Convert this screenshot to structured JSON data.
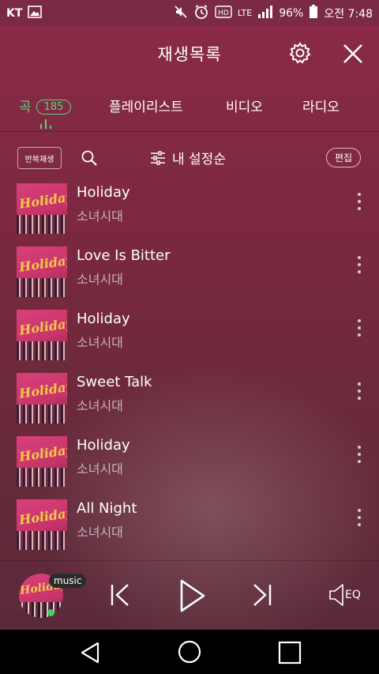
{
  "status_bar": {
    "carrier": "KT",
    "lte": "LTE",
    "battery": "96%",
    "time": "오전 7:48"
  },
  "header": {
    "title": "재생목록"
  },
  "tabs": [
    {
      "label": "곡",
      "badge": "185",
      "active": true
    },
    {
      "label": "플레이리스트",
      "active": false
    },
    {
      "label": "비디오",
      "active": false
    },
    {
      "label": "라디오",
      "active": false
    }
  ],
  "toolbar": {
    "repeat_label": "반복재생",
    "sort_label": "내 설정순",
    "edit_label": "편집"
  },
  "songs": [
    {
      "title": "Holiday",
      "artist": "소녀시대",
      "art_text": "Holiday"
    },
    {
      "title": "Love Is Bitter",
      "artist": "소녀시대",
      "art_text": "Holiday"
    },
    {
      "title": "Holiday",
      "artist": "소녀시대",
      "art_text": "Holiday"
    },
    {
      "title": "Sweet Talk",
      "artist": "소녀시대",
      "art_text": "Holiday"
    },
    {
      "title": "Holiday",
      "artist": "소녀시대",
      "art_text": "Holiday"
    },
    {
      "title": "All Night",
      "artist": "소녀시대",
      "art_text": "Holiday"
    }
  ],
  "player": {
    "badge": "music",
    "cover_text": "Holiday",
    "eq_label": "EQ"
  },
  "colors": {
    "accent": "#5fd17a",
    "background_top": "#8a2a45",
    "status_bar": "#7a2a44"
  }
}
